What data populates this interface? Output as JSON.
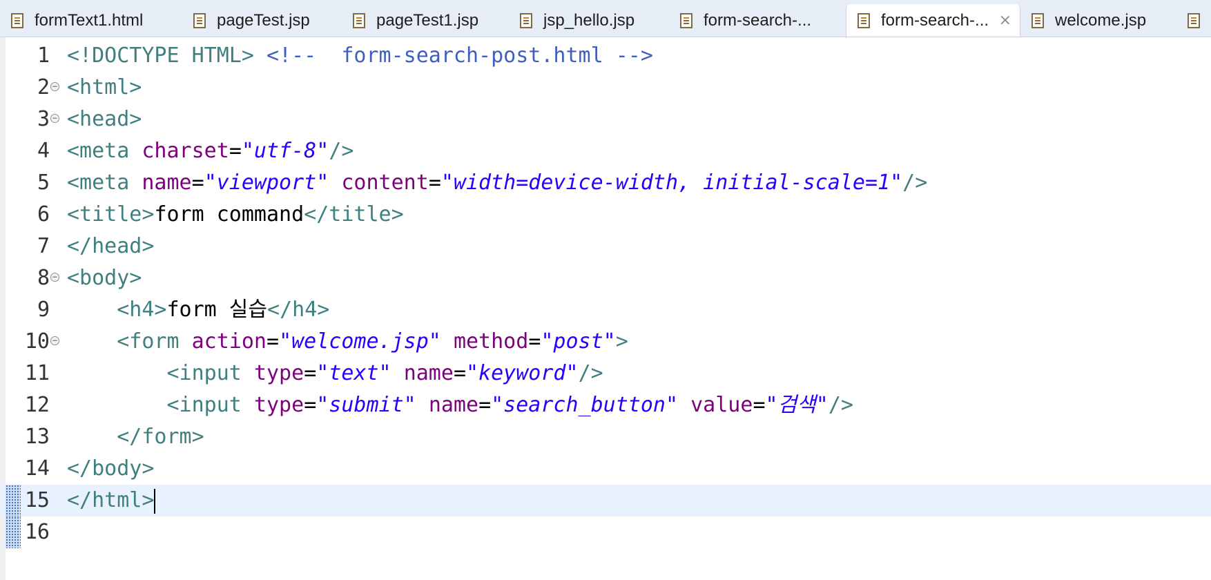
{
  "tabs": [
    {
      "label": "formText1.html",
      "active": false
    },
    {
      "label": "pageTest.jsp",
      "active": false
    },
    {
      "label": "pageTest1.jsp",
      "active": false
    },
    {
      "label": "jsp_hello.jsp",
      "active": false
    },
    {
      "label": "form-search-...",
      "active": false
    },
    {
      "label": "form-search-...",
      "active": true,
      "close": "⨯"
    },
    {
      "label": "welcome.jsp",
      "active": false
    }
  ],
  "editor": {
    "current_line": 15,
    "line_numbers": [
      "1",
      "2",
      "3",
      "4",
      "5",
      "6",
      "7",
      "8",
      "9",
      "10",
      "11",
      "12",
      "13",
      "14",
      "15",
      "16"
    ],
    "fold_lines": [
      2,
      3,
      8,
      10
    ],
    "lines": [
      [
        {
          "t": "tag",
          "s": "<!DOCTYPE HTML> "
        },
        {
          "t": "cmt",
          "s": "<!--  form-search-post.html -->"
        }
      ],
      [
        {
          "t": "tag",
          "s": "<html>"
        }
      ],
      [
        {
          "t": "tag",
          "s": "<head>"
        }
      ],
      [
        {
          "t": "tag",
          "s": "<meta "
        },
        {
          "t": "attr",
          "s": "charset"
        },
        {
          "t": "txt",
          "s": "="
        },
        {
          "t": "val",
          "s": "\"utf-8\""
        },
        {
          "t": "tag",
          "s": "/>"
        }
      ],
      [
        {
          "t": "tag",
          "s": "<meta "
        },
        {
          "t": "attr",
          "s": "name"
        },
        {
          "t": "txt",
          "s": "="
        },
        {
          "t": "val",
          "s": "\"viewport\""
        },
        {
          "t": "txt",
          "s": " "
        },
        {
          "t": "attr",
          "s": "content"
        },
        {
          "t": "txt",
          "s": "="
        },
        {
          "t": "val",
          "s": "\"width=device-width, initial-scale=1\""
        },
        {
          "t": "tag",
          "s": "/>"
        }
      ],
      [
        {
          "t": "tag",
          "s": "<title>"
        },
        {
          "t": "txt",
          "s": "form command"
        },
        {
          "t": "tag",
          "s": "</title>"
        }
      ],
      [
        {
          "t": "tag",
          "s": "</head>"
        }
      ],
      [
        {
          "t": "tag",
          "s": "<body>"
        }
      ],
      [
        {
          "t": "txt",
          "s": "    "
        },
        {
          "t": "tag",
          "s": "<h4>"
        },
        {
          "t": "txt",
          "s": "form 실습"
        },
        {
          "t": "tag",
          "s": "</h4>"
        }
      ],
      [
        {
          "t": "txt",
          "s": "    "
        },
        {
          "t": "tag",
          "s": "<form "
        },
        {
          "t": "attr",
          "s": "action"
        },
        {
          "t": "txt",
          "s": "="
        },
        {
          "t": "val",
          "s": "\"welcome.jsp\""
        },
        {
          "t": "txt",
          "s": " "
        },
        {
          "t": "attr",
          "s": "method"
        },
        {
          "t": "txt",
          "s": "="
        },
        {
          "t": "val",
          "s": "\"post\""
        },
        {
          "t": "tag",
          "s": ">"
        }
      ],
      [
        {
          "t": "txt",
          "s": "        "
        },
        {
          "t": "tag",
          "s": "<input "
        },
        {
          "t": "attr",
          "s": "type"
        },
        {
          "t": "txt",
          "s": "="
        },
        {
          "t": "val",
          "s": "\"text\""
        },
        {
          "t": "txt",
          "s": " "
        },
        {
          "t": "attr",
          "s": "name"
        },
        {
          "t": "txt",
          "s": "="
        },
        {
          "t": "val",
          "s": "\"keyword\""
        },
        {
          "t": "tag",
          "s": "/>"
        }
      ],
      [
        {
          "t": "txt",
          "s": "        "
        },
        {
          "t": "tag",
          "s": "<input "
        },
        {
          "t": "attr",
          "s": "type"
        },
        {
          "t": "txt",
          "s": "="
        },
        {
          "t": "val",
          "s": "\"submit\""
        },
        {
          "t": "txt",
          "s": " "
        },
        {
          "t": "attr",
          "s": "name"
        },
        {
          "t": "txt",
          "s": "="
        },
        {
          "t": "val",
          "s": "\"search_button\""
        },
        {
          "t": "txt",
          "s": " "
        },
        {
          "t": "attr",
          "s": "value"
        },
        {
          "t": "txt",
          "s": "="
        },
        {
          "t": "val",
          "s": "\"검색\""
        },
        {
          "t": "tag",
          "s": "/>"
        }
      ],
      [
        {
          "t": "txt",
          "s": "    "
        },
        {
          "t": "tag",
          "s": "</form>"
        }
      ],
      [
        {
          "t": "tag",
          "s": "</body>"
        }
      ],
      [
        {
          "t": "tag",
          "s": "</html>"
        }
      ],
      []
    ]
  }
}
